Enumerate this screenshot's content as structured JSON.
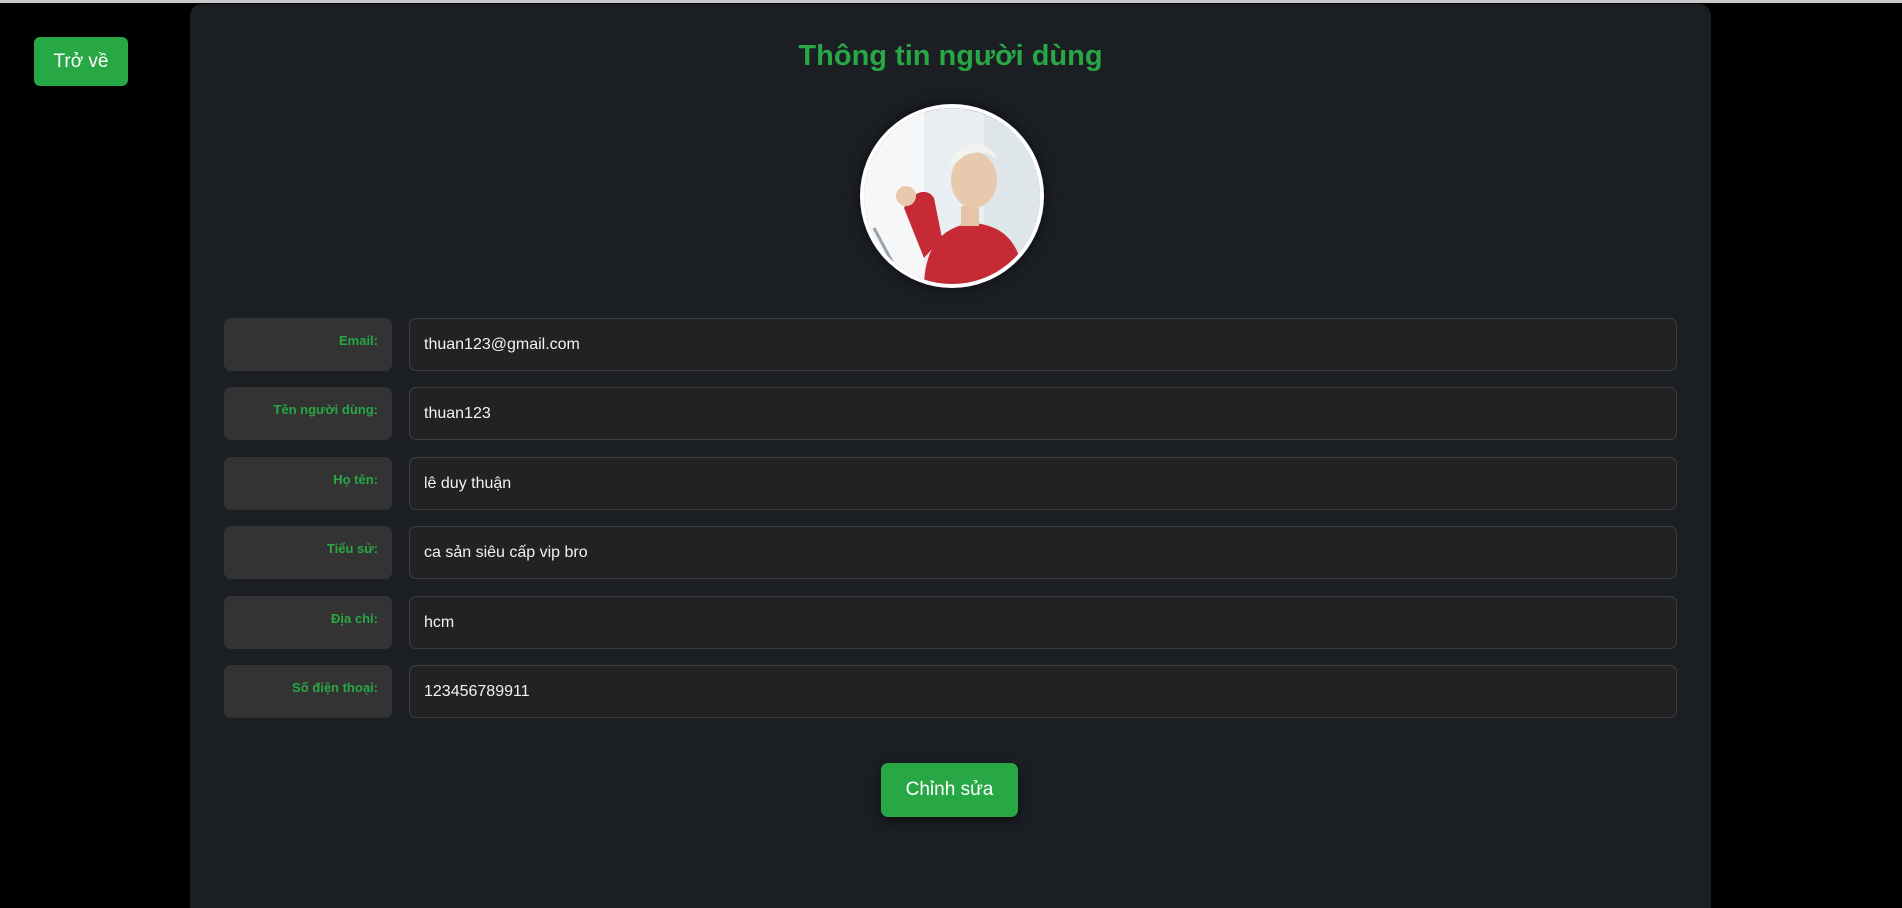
{
  "nav": {
    "back_label": "Trở về"
  },
  "profile": {
    "title": "Thông tin người dùng",
    "fields": [
      {
        "label": "Email:",
        "value": "thuan123@gmail.com"
      },
      {
        "label": "Tên người dùng:",
        "value": "thuan123"
      },
      {
        "label": "Họ tên:",
        "value": "lê duy thuận"
      },
      {
        "label": "Tiểu sử:",
        "value": "ca sản siêu cấp vip bro"
      },
      {
        "label": "Địa chỉ:",
        "value": "hcm"
      },
      {
        "label": "Số điện thoại:",
        "value": "123456789911"
      }
    ],
    "edit_label": "Chỉnh sửa"
  },
  "colors": {
    "accent": "#28a745",
    "background": "#000000",
    "panel": "#1b1e23",
    "label_bg": "#333333",
    "field_bg": "#222222"
  }
}
